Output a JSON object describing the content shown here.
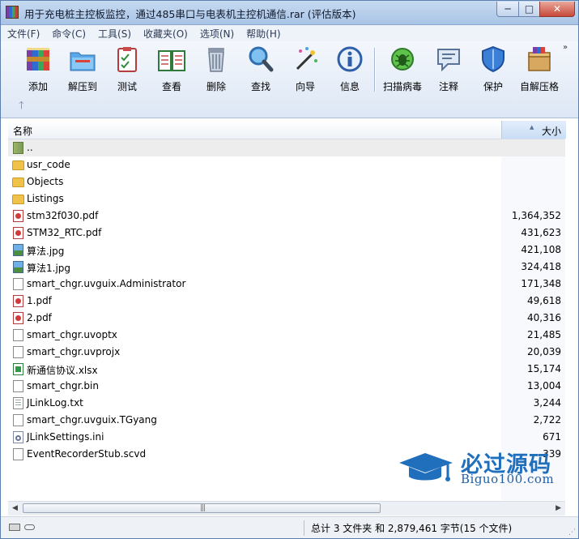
{
  "window": {
    "title": "用于充电桩主控板监控，通过485串口与电表机主控机通信.rar (评估版本)",
    "controls": {
      "minimize": "─",
      "maximize": "□",
      "close": "✕"
    }
  },
  "menu": [
    "文件(F)",
    "命令(C)",
    "工具(S)",
    "收藏夹(O)",
    "选项(N)",
    "帮助(H)"
  ],
  "toolbar": {
    "items": [
      {
        "label": "添加",
        "icon": "add-archive-icon"
      },
      {
        "label": "解压到",
        "icon": "extract-to-icon"
      },
      {
        "label": "测试",
        "icon": "test-icon"
      },
      {
        "label": "查看",
        "icon": "view-book-icon"
      },
      {
        "label": "删除",
        "icon": "delete-trash-icon"
      },
      {
        "label": "查找",
        "icon": "find-magnifier-icon"
      },
      {
        "label": "向导",
        "icon": "wizard-wand-icon"
      },
      {
        "label": "信息",
        "icon": "info-icon"
      },
      {
        "label": "扫描病毒",
        "icon": "virus-scan-icon"
      },
      {
        "label": "注释",
        "icon": "comment-icon"
      },
      {
        "label": "保护",
        "icon": "protect-shield-icon"
      },
      {
        "label": "自解压格",
        "icon": "sfx-box-icon"
      }
    ],
    "more": "»",
    "up": "🡑"
  },
  "columns": {
    "name": "名称",
    "size": "大小",
    "sort_caret": "▲"
  },
  "files": [
    {
      "name": "..",
      "size": "",
      "type": "up"
    },
    {
      "name": "usr_code",
      "size": "",
      "type": "folder"
    },
    {
      "name": "Objects",
      "size": "",
      "type": "folder"
    },
    {
      "name": "Listings",
      "size": "",
      "type": "folder"
    },
    {
      "name": "stm32f030.pdf",
      "size": "1,364,352",
      "type": "pdf"
    },
    {
      "name": "STM32_RTC.pdf",
      "size": "431,623",
      "type": "pdf"
    },
    {
      "name": "算法.jpg",
      "size": "421,108",
      "type": "img"
    },
    {
      "name": "算法1.jpg",
      "size": "324,418",
      "type": "img"
    },
    {
      "name": "smart_chgr.uvguix.Administrator",
      "size": "171,348",
      "type": "doc"
    },
    {
      "name": "1.pdf",
      "size": "49,618",
      "type": "pdf"
    },
    {
      "name": "2.pdf",
      "size": "40,316",
      "type": "pdf"
    },
    {
      "name": "smart_chgr.uvoptx",
      "size": "21,485",
      "type": "doc"
    },
    {
      "name": "smart_chgr.uvprojx",
      "size": "20,039",
      "type": "doc"
    },
    {
      "name": "新通信协议.xlsx",
      "size": "15,174",
      "type": "xls"
    },
    {
      "name": "smart_chgr.bin",
      "size": "13,004",
      "type": "doc"
    },
    {
      "name": "JLinkLog.txt",
      "size": "3,244",
      "type": "txt"
    },
    {
      "name": "smart_chgr.uvguix.TGyang",
      "size": "2,722",
      "type": "doc"
    },
    {
      "name": "JLinkSettings.ini",
      "size": "671",
      "type": "ini"
    },
    {
      "name": "EventRecorderStub.scvd",
      "size": "339",
      "type": "doc"
    }
  ],
  "scrollbar": {
    "left": "◀",
    "right": "▶",
    "grip": "|||"
  },
  "status": {
    "summary": "总计 3 文件夹 和 2,879,461 字节(15 个文件)"
  },
  "watermark": {
    "main": "必过源码",
    "sub": "Biguo100.com"
  },
  "colors": {
    "accent": "#1f6fbd",
    "title_bar": "#a9c4e6"
  }
}
